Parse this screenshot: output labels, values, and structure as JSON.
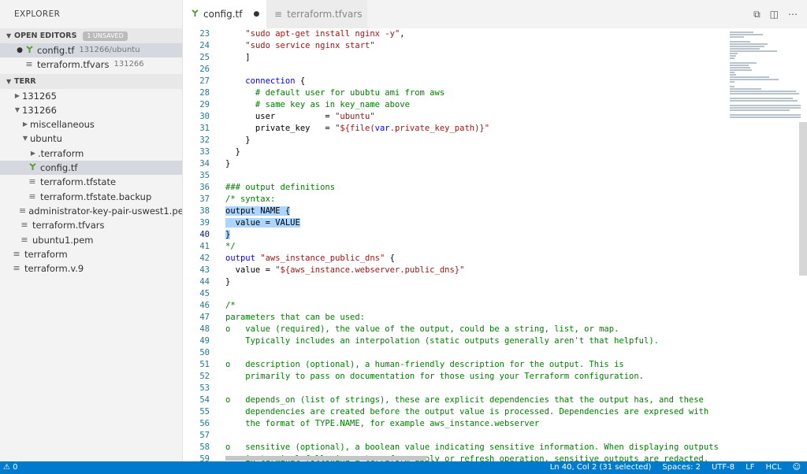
{
  "sidebar": {
    "title": "EXPLORER",
    "open_editors": {
      "label": "OPEN EDITORS",
      "badge": "1 UNSAVED",
      "items": [
        {
          "name": "config.tf",
          "suffix": "131266/ubuntu"
        },
        {
          "name": "terraform.tfvars",
          "suffix": "131266"
        }
      ]
    },
    "project": {
      "label": "TERR",
      "tree": [
        {
          "label": "131265"
        },
        {
          "label": "131266"
        },
        {
          "label": "miscellaneous"
        },
        {
          "label": "ubuntu"
        },
        {
          "label": ".terraform"
        },
        {
          "label": "config.tf"
        },
        {
          "label": "terraform.tfstate"
        },
        {
          "label": "terraform.tfstate.backup"
        },
        {
          "label": "administrator-key-pair-uswest1.pem"
        },
        {
          "label": "terraform.tfvars"
        },
        {
          "label": "ubuntu1.pem"
        },
        {
          "label": "terraform"
        },
        {
          "label": "terraform.v.9"
        }
      ]
    }
  },
  "tabs": [
    {
      "label": "config.tf"
    },
    {
      "label": "terraform.tfvars"
    }
  ],
  "editor": {
    "lines": [
      {
        "n": "23",
        "text": "    \"sudo apt-get install nginx -y\","
      },
      {
        "n": "24",
        "text": "    \"sudo service nginx start\""
      },
      {
        "n": "25",
        "text": "    ]"
      },
      {
        "n": "26",
        "text": ""
      },
      {
        "n": "27",
        "text": "    connection {"
      },
      {
        "n": "28",
        "text": "      # default user for ububtu ami from aws"
      },
      {
        "n": "29",
        "text": "      # same key as in key_name above"
      },
      {
        "n": "30",
        "text": "      user          = \"ubuntu\""
      },
      {
        "n": "31",
        "text": "      private_key   = \"${file(var.private_key_path)}\""
      },
      {
        "n": "32",
        "text": "    }"
      },
      {
        "n": "33",
        "text": "  }"
      },
      {
        "n": "34",
        "text": "}"
      },
      {
        "n": "35",
        "text": ""
      },
      {
        "n": "36",
        "text": "### output definitions"
      },
      {
        "n": "37",
        "text": "/* syntax:"
      },
      {
        "n": "38",
        "text": "output NAME {"
      },
      {
        "n": "39",
        "text": "  value = VALUE"
      },
      {
        "n": "40",
        "text": "}"
      },
      {
        "n": "41",
        "text": "*/"
      },
      {
        "n": "42",
        "text": "output \"aws_instance_public_dns\" {"
      },
      {
        "n": "43",
        "text": "  value = \"${aws_instance.webserver.public_dns}\""
      },
      {
        "n": "44",
        "text": "}"
      },
      {
        "n": "45",
        "text": ""
      },
      {
        "n": "46",
        "text": "/*"
      },
      {
        "n": "47",
        "text": "parameters that can be used:"
      },
      {
        "n": "48",
        "text": "o   value (required), the value of the output, could be a string, list, or map."
      },
      {
        "n": "49",
        "text": "    Typically includes an interpolation (static outputs generally aren't that helpful)."
      },
      {
        "n": "50",
        "text": ""
      },
      {
        "n": "51",
        "text": "o   description (optional), a human-friendly description for the output. This is"
      },
      {
        "n": "52",
        "text": "    primarily to pass on documentation for those using your Terraform configuration."
      },
      {
        "n": "53",
        "text": ""
      },
      {
        "n": "54",
        "text": "o   depends_on (list of strings), these are explicit dependencies that the output has, and these"
      },
      {
        "n": "55",
        "text": "    dependencies are created before the output value is processed. Dependencies are expresed with"
      },
      {
        "n": "56",
        "text": "    the format of TYPE.NAME, for example aws_instance.webserver"
      },
      {
        "n": "57",
        "text": ""
      },
      {
        "n": "58",
        "text": "o   sensitive (optional), a boolean value indicating sensitive information. When displaying outputs"
      },
      {
        "n": "59",
        "text": "    in terminal following a terraform apply or refresh operation, sensitive outputs are redacted,"
      }
    ]
  },
  "statusbar": {
    "problems": "0",
    "position": "Ln 40, Col 2 (31 selected)",
    "spaces": "Spaces: 2",
    "encoding": "UTF-8",
    "eol": "LF",
    "language": "HCL"
  },
  "colors": {
    "statusbar": "#007acc",
    "selection": "#add6ff",
    "comment": "#008000",
    "string": "#a31515",
    "keyword": "#0000ff",
    "line_number": "#237893"
  }
}
